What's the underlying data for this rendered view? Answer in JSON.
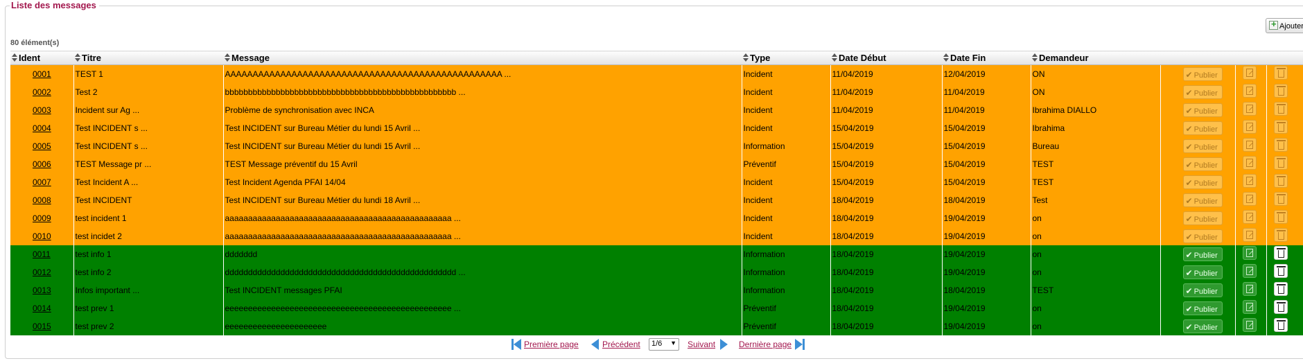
{
  "panel": {
    "legend": "Liste des messages",
    "count": "80 élément(s)",
    "add_label": "Ajouter"
  },
  "columns": [
    "Ident",
    "Titre",
    "Message",
    "Type",
    "Date Début",
    "Date Fin",
    "Demandeur"
  ],
  "publish_label": "Publier",
  "colors": {
    "incident": "#ffa200",
    "information": "#008000",
    "accent": "#a2174d"
  },
  "rows": [
    {
      "ident": "0001",
      "titre": "TEST 1",
      "message": "AAAAAAAAAAAAAAAAAAAAAAAAAAAAAAAAAAAAAAAAAAAAAAAAAA ...",
      "type": "Incident",
      "debut": "11/04/2019",
      "fin": "12/04/2019",
      "demandeur": "ON",
      "status": "incident"
    },
    {
      "ident": "0002",
      "titre": "Test 2",
      "message": "bbbbbbbbbbbbbbbbbbbbbbbbbbbbbbbbbbbbbbbbbbbbbbbbbb ...",
      "type": "Incident",
      "debut": "11/04/2019",
      "fin": "11/04/2019",
      "demandeur": "ON",
      "status": "incident"
    },
    {
      "ident": "0003",
      "titre": "Incident sur Ag ...",
      "message": "Problème de synchronisation avec INCA",
      "type": "Incident",
      "debut": "11/04/2019",
      "fin": "11/04/2019",
      "demandeur": "Ibrahima DIALLO",
      "status": "incident"
    },
    {
      "ident": "0004",
      "titre": "Test INCIDENT s ...",
      "message": "Test INCIDENT sur Bureau Métier du lundi 15 Avril ...",
      "type": "Incident",
      "debut": "15/04/2019",
      "fin": "15/04/2019",
      "demandeur": "Ibrahima",
      "status": "incident"
    },
    {
      "ident": "0005",
      "titre": "Test INCIDENT s ...",
      "message": "Test INCIDENT sur Bureau Métier du lundi 15 Avril ...",
      "type": "Information",
      "debut": "15/04/2019",
      "fin": "15/04/2019",
      "demandeur": "Bureau",
      "status": "incident"
    },
    {
      "ident": "0006",
      "titre": "TEST Message pr ...",
      "message": "TEST Message préventif du 15 Avril",
      "type": "Préventif",
      "debut": "15/04/2019",
      "fin": "15/04/2019",
      "demandeur": "TEST",
      "status": "incident"
    },
    {
      "ident": "0007",
      "titre": "Test Incident A ...",
      "message": "Test Incident Agenda PFAI 14/04",
      "type": "Incident",
      "debut": "15/04/2019",
      "fin": "15/04/2019",
      "demandeur": "TEST",
      "status": "incident"
    },
    {
      "ident": "0008",
      "titre": "Test INCIDENT",
      "message": "Test INCIDENT sur Bureau Métier du lundi 18 Avril ...",
      "type": "Incident",
      "debut": "18/04/2019",
      "fin": "18/04/2019",
      "demandeur": "Test",
      "status": "incident"
    },
    {
      "ident": "0009",
      "titre": "test incident 1",
      "message": "aaaaaaaaaaaaaaaaaaaaaaaaaaaaaaaaaaaaaaaaaaaaaaaaa ...",
      "type": "Incident",
      "debut": "18/04/2019",
      "fin": "19/04/2019",
      "demandeur": "on",
      "status": "incident"
    },
    {
      "ident": "0010",
      "titre": "test incidet 2",
      "message": "aaaaaaaaaaaaaaaaaaaaaaaaaaaaaaaaaaaaaaaaaaaaaaaaa ...",
      "type": "Incident",
      "debut": "18/04/2019",
      "fin": "19/04/2019",
      "demandeur": "on",
      "status": "incident"
    },
    {
      "ident": "0011",
      "titre": "test info 1",
      "message": "ddddddd",
      "type": "Information",
      "debut": "18/04/2019",
      "fin": "19/04/2019",
      "demandeur": "on",
      "status": "info"
    },
    {
      "ident": "0012",
      "titre": "test info 2",
      "message": "dddddddddddddddddddddddddddddddddddddddddddddddddd ...",
      "type": "Information",
      "debut": "18/04/2019",
      "fin": "19/04/2019",
      "demandeur": "on",
      "status": "info"
    },
    {
      "ident": "0013",
      "titre": "Infos important ...",
      "message": "Test INCIDENT messages PFAI",
      "type": "Information",
      "debut": "18/04/2019",
      "fin": "18/04/2019",
      "demandeur": "TEST",
      "status": "info"
    },
    {
      "ident": "0014",
      "titre": "test prev 1",
      "message": "eeeeeeeeeeeeeeeeeeeeeeeeeeeeeeeeeeeeeeeeeeeeeeeee ...",
      "type": "Préventif",
      "debut": "18/04/2019",
      "fin": "19/04/2019",
      "demandeur": "on",
      "status": "info"
    },
    {
      "ident": "0015",
      "titre": "test prev 2",
      "message": "eeeeeeeeeeeeeeeeeeeeee",
      "type": "Préventif",
      "debut": "18/04/2019",
      "fin": "19/04/2019",
      "demandeur": "on",
      "status": "info"
    }
  ],
  "pager": {
    "first": "Première page",
    "prev": "Précédent",
    "page": "1/6",
    "next": "Suivant",
    "last": "Dernière page"
  }
}
